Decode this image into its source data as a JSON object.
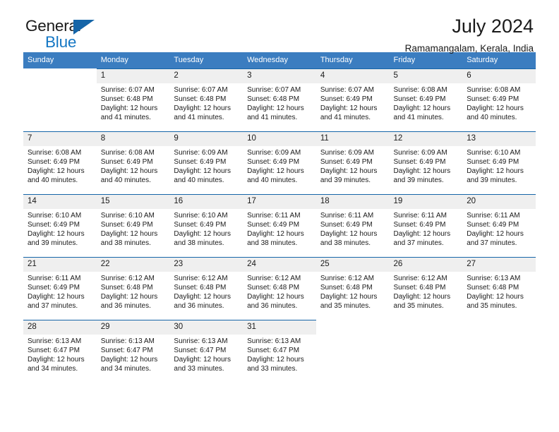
{
  "brand": {
    "name_part1": "General",
    "name_part2": "Blue",
    "triangle_color": "#1565a8",
    "blue_color": "#1577c4"
  },
  "header": {
    "title": "July 2024",
    "subtitle": "Ramamangalam, Kerala, India"
  },
  "theme": {
    "header_row_bg": "#3b7dc0",
    "daynum_bg": "#efefef",
    "week_divider": "#1565a8"
  },
  "weekdays": [
    "Sunday",
    "Monday",
    "Tuesday",
    "Wednesday",
    "Thursday",
    "Friday",
    "Saturday"
  ],
  "weeks": [
    [
      {
        "empty": true
      },
      {
        "day": "1",
        "sunrise": "Sunrise: 6:07 AM",
        "sunset": "Sunset: 6:48 PM",
        "daylight": "Daylight: 12 hours and 41 minutes."
      },
      {
        "day": "2",
        "sunrise": "Sunrise: 6:07 AM",
        "sunset": "Sunset: 6:48 PM",
        "daylight": "Daylight: 12 hours and 41 minutes."
      },
      {
        "day": "3",
        "sunrise": "Sunrise: 6:07 AM",
        "sunset": "Sunset: 6:48 PM",
        "daylight": "Daylight: 12 hours and 41 minutes."
      },
      {
        "day": "4",
        "sunrise": "Sunrise: 6:07 AM",
        "sunset": "Sunset: 6:49 PM",
        "daylight": "Daylight: 12 hours and 41 minutes."
      },
      {
        "day": "5",
        "sunrise": "Sunrise: 6:08 AM",
        "sunset": "Sunset: 6:49 PM",
        "daylight": "Daylight: 12 hours and 41 minutes."
      },
      {
        "day": "6",
        "sunrise": "Sunrise: 6:08 AM",
        "sunset": "Sunset: 6:49 PM",
        "daylight": "Daylight: 12 hours and 40 minutes."
      }
    ],
    [
      {
        "day": "7",
        "sunrise": "Sunrise: 6:08 AM",
        "sunset": "Sunset: 6:49 PM",
        "daylight": "Daylight: 12 hours and 40 minutes."
      },
      {
        "day": "8",
        "sunrise": "Sunrise: 6:08 AM",
        "sunset": "Sunset: 6:49 PM",
        "daylight": "Daylight: 12 hours and 40 minutes."
      },
      {
        "day": "9",
        "sunrise": "Sunrise: 6:09 AM",
        "sunset": "Sunset: 6:49 PM",
        "daylight": "Daylight: 12 hours and 40 minutes."
      },
      {
        "day": "10",
        "sunrise": "Sunrise: 6:09 AM",
        "sunset": "Sunset: 6:49 PM",
        "daylight": "Daylight: 12 hours and 40 minutes."
      },
      {
        "day": "11",
        "sunrise": "Sunrise: 6:09 AM",
        "sunset": "Sunset: 6:49 PM",
        "daylight": "Daylight: 12 hours and 39 minutes."
      },
      {
        "day": "12",
        "sunrise": "Sunrise: 6:09 AM",
        "sunset": "Sunset: 6:49 PM",
        "daylight": "Daylight: 12 hours and 39 minutes."
      },
      {
        "day": "13",
        "sunrise": "Sunrise: 6:10 AM",
        "sunset": "Sunset: 6:49 PM",
        "daylight": "Daylight: 12 hours and 39 minutes."
      }
    ],
    [
      {
        "day": "14",
        "sunrise": "Sunrise: 6:10 AM",
        "sunset": "Sunset: 6:49 PM",
        "daylight": "Daylight: 12 hours and 39 minutes."
      },
      {
        "day": "15",
        "sunrise": "Sunrise: 6:10 AM",
        "sunset": "Sunset: 6:49 PM",
        "daylight": "Daylight: 12 hours and 38 minutes."
      },
      {
        "day": "16",
        "sunrise": "Sunrise: 6:10 AM",
        "sunset": "Sunset: 6:49 PM",
        "daylight": "Daylight: 12 hours and 38 minutes."
      },
      {
        "day": "17",
        "sunrise": "Sunrise: 6:11 AM",
        "sunset": "Sunset: 6:49 PM",
        "daylight": "Daylight: 12 hours and 38 minutes."
      },
      {
        "day": "18",
        "sunrise": "Sunrise: 6:11 AM",
        "sunset": "Sunset: 6:49 PM",
        "daylight": "Daylight: 12 hours and 38 minutes."
      },
      {
        "day": "19",
        "sunrise": "Sunrise: 6:11 AM",
        "sunset": "Sunset: 6:49 PM",
        "daylight": "Daylight: 12 hours and 37 minutes."
      },
      {
        "day": "20",
        "sunrise": "Sunrise: 6:11 AM",
        "sunset": "Sunset: 6:49 PM",
        "daylight": "Daylight: 12 hours and 37 minutes."
      }
    ],
    [
      {
        "day": "21",
        "sunrise": "Sunrise: 6:11 AM",
        "sunset": "Sunset: 6:49 PM",
        "daylight": "Daylight: 12 hours and 37 minutes."
      },
      {
        "day": "22",
        "sunrise": "Sunrise: 6:12 AM",
        "sunset": "Sunset: 6:48 PM",
        "daylight": "Daylight: 12 hours and 36 minutes."
      },
      {
        "day": "23",
        "sunrise": "Sunrise: 6:12 AM",
        "sunset": "Sunset: 6:48 PM",
        "daylight": "Daylight: 12 hours and 36 minutes."
      },
      {
        "day": "24",
        "sunrise": "Sunrise: 6:12 AM",
        "sunset": "Sunset: 6:48 PM",
        "daylight": "Daylight: 12 hours and 36 minutes."
      },
      {
        "day": "25",
        "sunrise": "Sunrise: 6:12 AM",
        "sunset": "Sunset: 6:48 PM",
        "daylight": "Daylight: 12 hours and 35 minutes."
      },
      {
        "day": "26",
        "sunrise": "Sunrise: 6:12 AM",
        "sunset": "Sunset: 6:48 PM",
        "daylight": "Daylight: 12 hours and 35 minutes."
      },
      {
        "day": "27",
        "sunrise": "Sunrise: 6:13 AM",
        "sunset": "Sunset: 6:48 PM",
        "daylight": "Daylight: 12 hours and 35 minutes."
      }
    ],
    [
      {
        "day": "28",
        "sunrise": "Sunrise: 6:13 AM",
        "sunset": "Sunset: 6:47 PM",
        "daylight": "Daylight: 12 hours and 34 minutes."
      },
      {
        "day": "29",
        "sunrise": "Sunrise: 6:13 AM",
        "sunset": "Sunset: 6:47 PM",
        "daylight": "Daylight: 12 hours and 34 minutes."
      },
      {
        "day": "30",
        "sunrise": "Sunrise: 6:13 AM",
        "sunset": "Sunset: 6:47 PM",
        "daylight": "Daylight: 12 hours and 33 minutes."
      },
      {
        "day": "31",
        "sunrise": "Sunrise: 6:13 AM",
        "sunset": "Sunset: 6:47 PM",
        "daylight": "Daylight: 12 hours and 33 minutes."
      },
      {
        "empty": true
      },
      {
        "empty": true
      },
      {
        "empty": true
      }
    ]
  ]
}
